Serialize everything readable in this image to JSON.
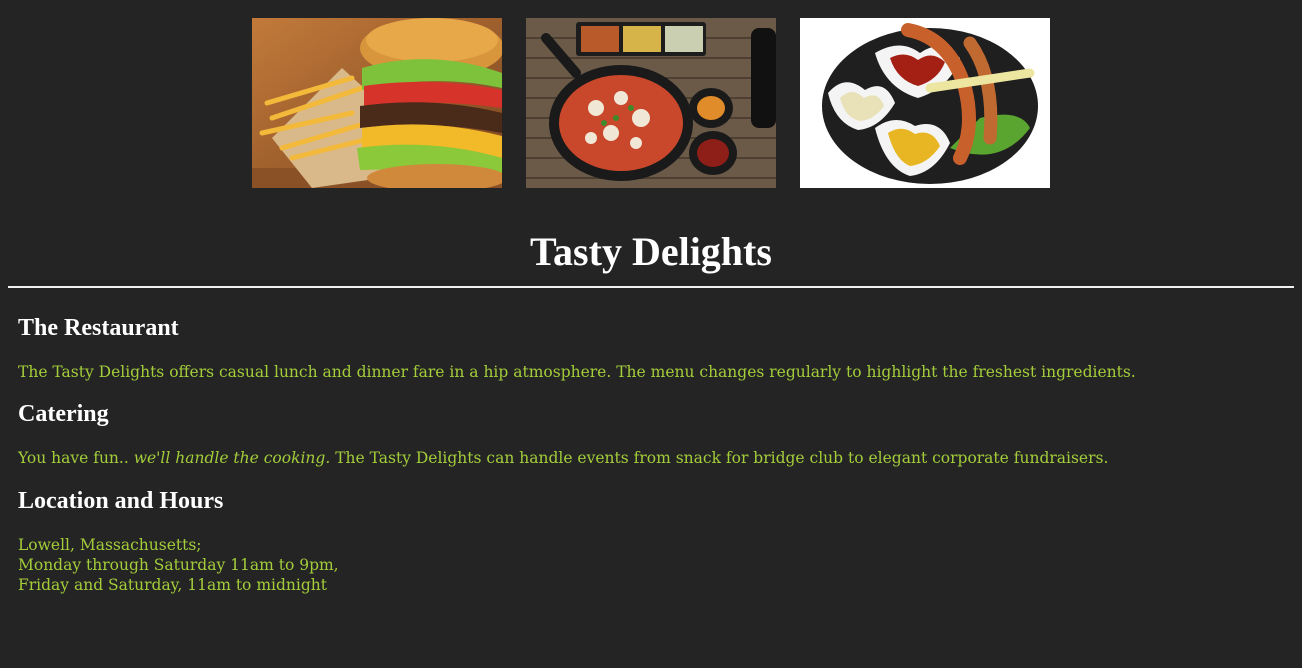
{
  "gallery": {
    "images": [
      {
        "name": "burger-and-fries-photo"
      },
      {
        "name": "korean-skillet-meal-photo"
      },
      {
        "name": "sausage-platter-photo"
      }
    ]
  },
  "header": {
    "title": "Tasty Delights"
  },
  "sections": {
    "restaurant": {
      "heading": "The Restaurant",
      "text": "The Tasty Delights offers casual lunch and dinner fare in a hip atmosphere. The menu changes regularly to highlight the freshest ingredients."
    },
    "catering": {
      "heading": "Catering",
      "text_lead": "You have fun.. ",
      "text_emphasis": "we'll handle the cooking.",
      "text_rest": " The Tasty Delights can handle events from snack for bridge club to elegant corporate fundraisers."
    },
    "location": {
      "heading": "Location and Hours",
      "lines": [
        "Lowell, Massachusetts;",
        "Monday through Saturday 11am to 9pm,",
        "Friday and Saturday, 11am to midnight"
      ]
    }
  },
  "colors": {
    "background": "#242424",
    "heading": "#ffffff",
    "body_text": "#a3cd3a"
  }
}
